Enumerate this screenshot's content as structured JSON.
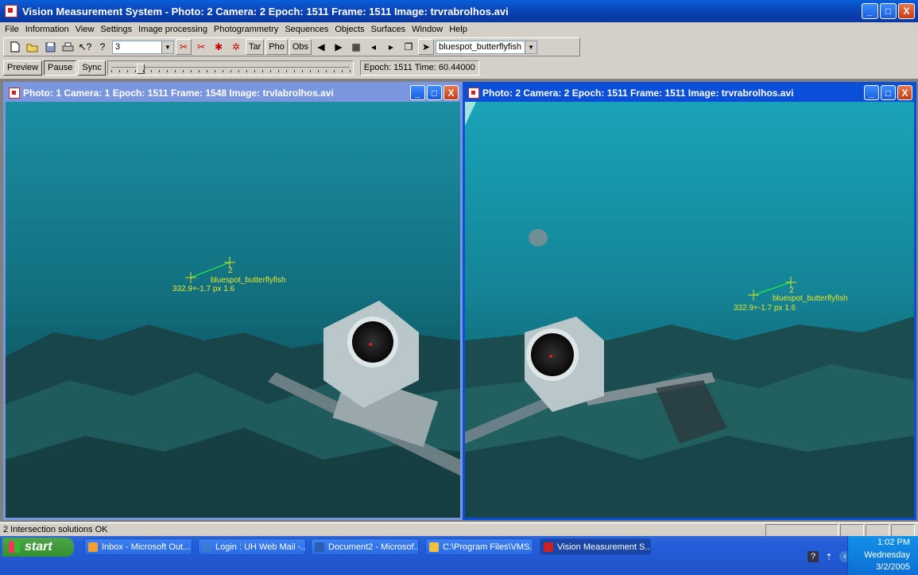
{
  "window": {
    "title": "Vision Measurement System - Photo: 2 Camera: 2 Epoch: 1511  Frame: 1511 Image: trvrabrolhos.avi",
    "min_label": "_",
    "max_label": "□",
    "close_label": "X"
  },
  "menu": [
    "File",
    "Information",
    "View",
    "Settings",
    "Image processing",
    "Photogrammetry",
    "Sequences",
    "Objects",
    "Surfaces",
    "Window",
    "Help"
  ],
  "toolbar": {
    "epoch_combo_value": "3",
    "tar_label": "Tar",
    "pho_label": "Pho",
    "obs_label": "Obs",
    "species_combo_value": "bluespot_butterflyfish"
  },
  "controls": {
    "preview_label": "Preview",
    "pause_label": "Pause",
    "sync_label": "Sync",
    "slider_position": 0.12,
    "epoch_time": "Epoch: 1511 Time: 60.44000"
  },
  "photos": [
    {
      "title": "Photo: 1 Camera: 1 Epoch: 1511   Frame: 1548 Image: trvlabrolhos.avi",
      "point_label": "2",
      "species_label": "bluespot_butterflyfish",
      "measure_label": "332.9+-1.7 px 1.6"
    },
    {
      "title": "Photo: 2 Camera: 2 Epoch: 1511  Frame: 1511 Image: trvrabrolhos.avi",
      "point_label": "2",
      "species_label": "bluespot_butterflyfish",
      "measure_label": "332.9+-1.7 px 1.6"
    }
  ],
  "status": {
    "text": "2 Intersection solutions OK"
  },
  "taskbar": {
    "start_label": "start",
    "tasks": [
      {
        "label": "Inbox - Microsoft Out...",
        "color": "#f0a030"
      },
      {
        "label": "Login : UH Web Mail -...",
        "color": "#3a7bd5"
      },
      {
        "label": "Document2 - Microsof...",
        "color": "#2a5db0"
      },
      {
        "label": "C:\\Program Files\\VMS...",
        "color": "#f0c040"
      },
      {
        "label": "Vision Measurement S...",
        "color": "#c22"
      }
    ],
    "clock": {
      "time": "1:02 PM",
      "day": "Wednesday",
      "date": "3/2/2005"
    }
  }
}
